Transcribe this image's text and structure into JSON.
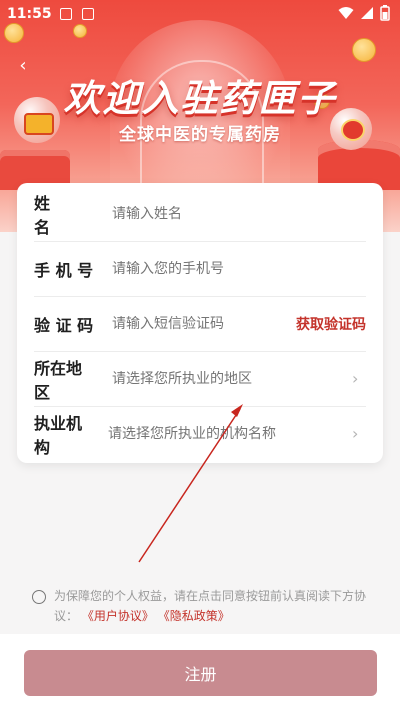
{
  "status_bar": {
    "time": "11:55"
  },
  "hero": {
    "title": "欢迎入驻药匣子",
    "subtitle": "全球中医的专属药房"
  },
  "form": {
    "fields": [
      {
        "label": "姓　　名",
        "placeholder": "请输入姓名"
      },
      {
        "label": "手 机 号",
        "placeholder": "请输入您的手机号"
      },
      {
        "label": "验 证 码",
        "placeholder": "请输入短信验证码",
        "action": "获取验证码"
      },
      {
        "label": "所在地区",
        "placeholder": "请选择您所执业的地区"
      },
      {
        "label": "执业机构",
        "placeholder": "请选择您所执业的机构名称"
      }
    ]
  },
  "agreement": {
    "text": "为保障您的个人权益，请在点击同意按钮前认真阅读下方协议：",
    "link_user": "《用户协议》",
    "link_privacy": "《隐私政策》"
  },
  "footer": {
    "register_label": "注册"
  },
  "colors": {
    "brand_red": "#c4332b",
    "button_disabled": "#c88b90",
    "hero_red": "#ee4a3e"
  },
  "icons": [
    "back-arrow-icon",
    "chevron-right-icon",
    "wifi-icon",
    "battery-icon"
  ]
}
